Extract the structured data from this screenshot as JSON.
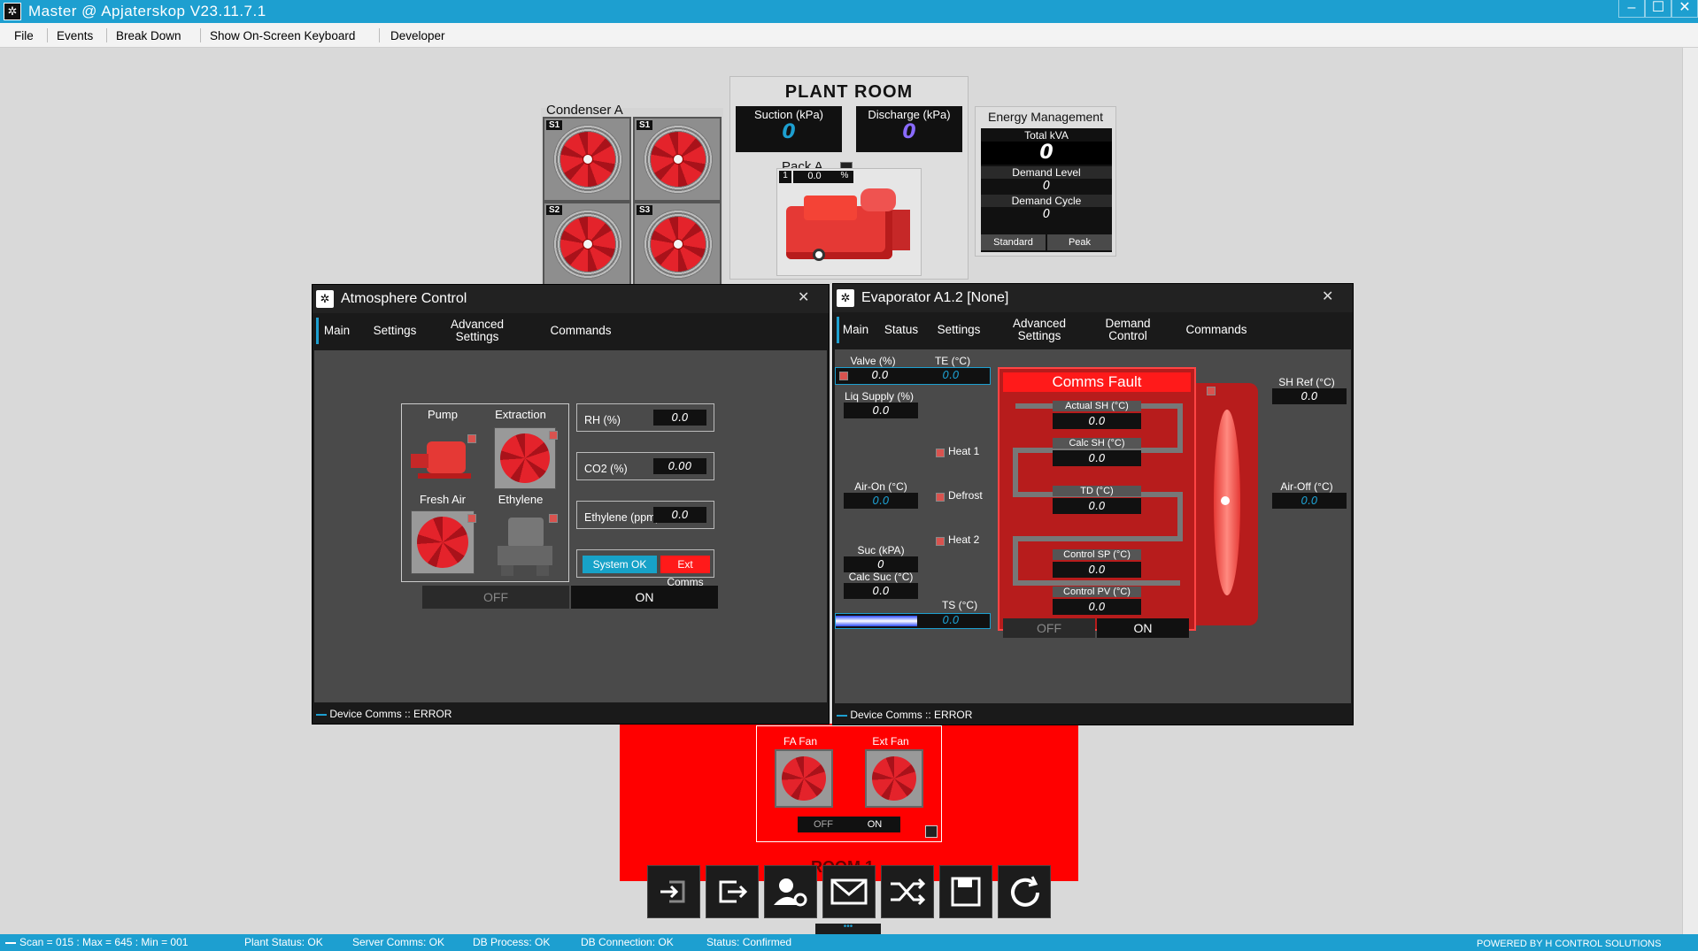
{
  "app": {
    "title": "Master @ Apjaterskop V23.11.7.1"
  },
  "menu": [
    "File",
    "Events",
    "Break Down",
    "Show On-Screen Keyboard",
    "Developer"
  ],
  "plant_room": {
    "title": "PLANT ROOM",
    "suction_label": "Suction (kPa)",
    "suction_value": "0",
    "discharge_label": "Discharge (kPa)",
    "discharge_value": "0",
    "pack_label": "Pack A",
    "pack_tag": "1",
    "pack_value": "0.0",
    "pack_unit": "%"
  },
  "condenser": {
    "title": "Condenser A",
    "fans": [
      "S1",
      "S1",
      "S2",
      "S3"
    ]
  },
  "energy": {
    "title": "Energy Management",
    "total_kva_label": "Total kVA",
    "total_kva_value": "0",
    "demand_level_label": "Demand Level",
    "demand_level_value": "0",
    "demand_cycle_label": "Demand Cycle",
    "demand_cycle_value": "0",
    "standard": "Standard",
    "peak": "Peak"
  },
  "atmosphere": {
    "title": "Atmosphere Control",
    "tabs": [
      "Main",
      "Settings",
      "Advanced Settings",
      "Commands"
    ],
    "pump": "Pump",
    "extraction": "Extraction",
    "fresh_air": "Fresh Air",
    "ethylene": "Ethylene",
    "rh_label": "RH (%)",
    "rh_value": "0.0",
    "co2_label": "CO2 (%)",
    "co2_value": "0.00",
    "eth_label": "Ethylene (ppm)",
    "eth_value": "0.0",
    "system_ok": "System OK",
    "ext_comms": "Ext Comms",
    "off": "OFF",
    "on": "ON",
    "footer": "Device Comms :: ERROR"
  },
  "evaporator": {
    "title": "Evaporator A1.2 [None]",
    "tabs": [
      "Main",
      "Status",
      "Settings",
      "Advanced Settings",
      "Demand Control",
      "Commands"
    ],
    "valve_label": "Valve (%)",
    "valve_value": "0.0",
    "te_label": "TE (°C)",
    "te_value": "0.0",
    "liq_label": "Liq Supply (%)",
    "liq_value": "0.0",
    "heat1": "Heat 1",
    "defrost": "Defrost",
    "heat2": "Heat 2",
    "airon_label": "Air-On (°C)",
    "airon_value": "0.0",
    "suc_label": "Suc (kPA)",
    "suc_value": "0",
    "calcsuc_label": "Calc Suc (°C)",
    "calcsuc_value": "0.0",
    "ts_label": "TS (°C)",
    "ts_value": "0.0",
    "fault": "Comms Fault",
    "actual_sh_label": "Actual SH (°C)",
    "actual_sh_value": "0.0",
    "calc_sh_label": "Calc SH (°C)",
    "calc_sh_value": "0.0",
    "td_label": "TD (°C)",
    "td_value": "0.0",
    "control_sp_label": "Control SP (°C)",
    "control_sp_value": "0.0",
    "control_pv_label": "Control PV (°C)",
    "control_pv_value": "0.0",
    "off": "OFF",
    "on": "ON",
    "shref_label": "SH Ref (°C)",
    "shref_value": "0.0",
    "airoff_label": "Air-Off (°C)",
    "airoff_value": "0.0",
    "footer": "Device Comms :: ERROR"
  },
  "room": {
    "fa_fan": "FA Fan",
    "ext_fan": "Ext Fan",
    "off": "OFF",
    "on": "ON",
    "room_label": "ROOM 1"
  },
  "toolbar": [
    "login-icon",
    "logout-icon",
    "user-settings-icon",
    "mail-icon",
    "shuffle-icon",
    "save-icon",
    "refresh-icon"
  ],
  "status": {
    "scan": "Scan = 015 : Max = 645 : Min = 001",
    "plant": "Plant Status: OK",
    "server": "Server Comms: OK",
    "db_process": "DB Process:  OK",
    "db_conn": "DB Connection:  OK",
    "status": "Status:  Confirmed",
    "powered": "POWERED BY H CONTROL SOLUTIONS"
  },
  "colors": {
    "accent": "#1d9fd0",
    "fault": "#ff1a1a",
    "dark_red": "#b71c1c",
    "ok_blue": "#17a2c8"
  }
}
